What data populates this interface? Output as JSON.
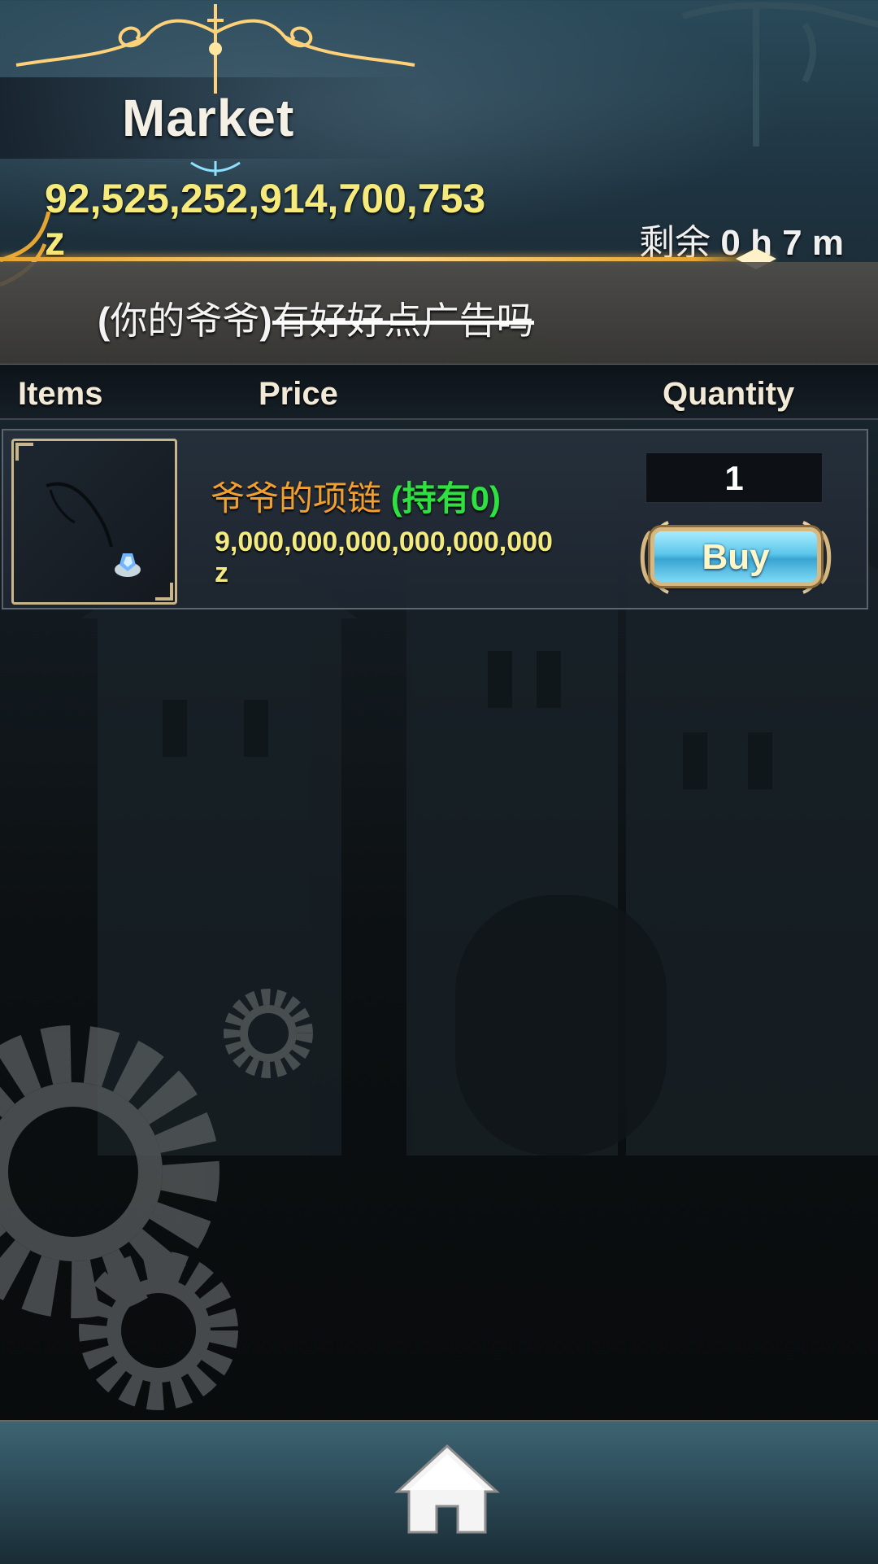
{
  "header": {
    "title": "Market",
    "money_line1": "92,525,252,914,700,753",
    "money_line2": "z",
    "timer_label": "剩余",
    "timer_value": "0 h 7 m"
  },
  "notice": {
    "open_paren": "(",
    "text_normal": "你的爷爷",
    "close_paren": ")",
    "text_struck": "有好好点广告吗"
  },
  "columns": {
    "items": "Items",
    "price": "Price",
    "quantity": "Quantity"
  },
  "items": [
    {
      "name": "爷爷的项链",
      "held": "(持有0)",
      "price_line1": "9,000,000,000,000,000,000",
      "price_line2": "z",
      "quantity": "1",
      "buy_label": "Buy",
      "icon": "necklace-icon"
    }
  ],
  "footer": {
    "home_icon": "home-icon"
  },
  "colors": {
    "money": "#f6eb7a",
    "item_name": "#f0a030",
    "held": "#2ee040",
    "gold_trim": "#e5a533"
  }
}
